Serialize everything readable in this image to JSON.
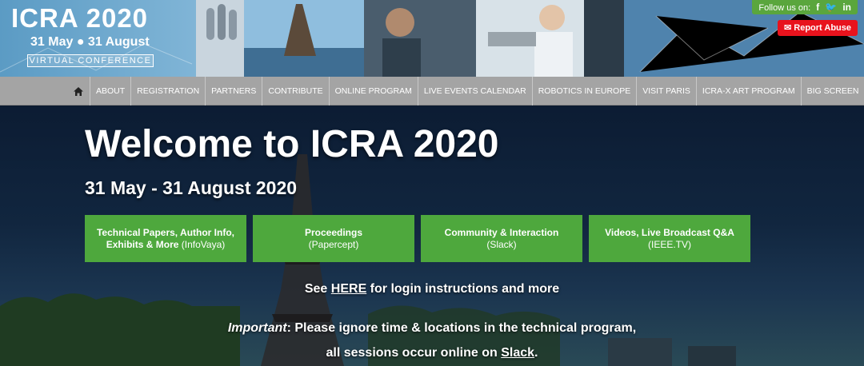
{
  "header": {
    "logo_title": "ICRA 2020",
    "logo_dates": "31 May ● 31 August",
    "logo_virtual": "VIRTUAL CONFERENCE",
    "follow_label": "Follow us on:",
    "follow_icons": "f 🐦 in",
    "report_abuse": "Report Abuse"
  },
  "nav": {
    "home_icon": "home-icon",
    "items": [
      "ABOUT",
      "REGISTRATION",
      "PARTNERS",
      "CONTRIBUTE",
      "ONLINE PROGRAM",
      "LIVE EVENTS CALENDAR",
      "ROBOTICS IN EUROPE",
      "VISIT PARIS",
      "ICRA-X ART PROGRAM",
      "BIG SCREEN"
    ]
  },
  "hero": {
    "title": "Welcome to ICRA 2020",
    "dates": "31 May - 31 August 2020",
    "buttons": [
      {
        "line1": "Technical Papers, Author Info,",
        "line2": "Exhibits & More",
        "line3": " (InfoVaya)"
      },
      {
        "line1": "Proceedings",
        "line2": "",
        "line3": "(Papercept)"
      },
      {
        "line1": "Community & Interaction",
        "line2": "",
        "line3": "(Slack)"
      },
      {
        "line1": "Videos, Live Broadcast Q&A",
        "line2": "",
        "line3": "(IEEE.TV)"
      }
    ],
    "login_pre": "See ",
    "login_link": "HERE",
    "login_post": " for login instructions and more",
    "important_label": "Important",
    "important_text": ": Please ignore time & locations in the technical program,",
    "sessions_pre": "all sessions occur online on ",
    "sessions_link": "Slack",
    "sessions_post": "."
  },
  "colors": {
    "nav_bg": "#a4a4a4",
    "button_green": "#4ea83d",
    "abuse_red": "#e8131d",
    "follow_green": "#5aa63d"
  }
}
